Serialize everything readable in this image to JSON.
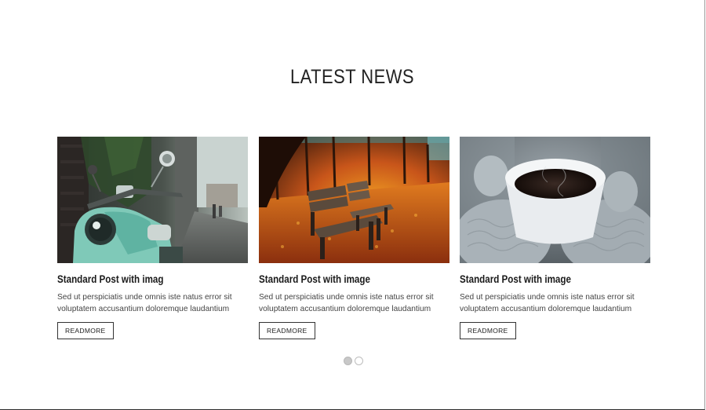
{
  "section": {
    "title": "LATEST NEWS"
  },
  "posts": [
    {
      "title": "Standard Post with imag",
      "excerpt": "Sed ut perspiciatis unde omnis iste natus error sit voluptatem accusantium doloremque laudantium",
      "button": "READMORE",
      "image": "scooter-photo"
    },
    {
      "title": "Standard Post with image",
      "excerpt": "Sed ut perspiciatis unde omnis iste natus error sit voluptatem accusantium doloremque laudantium",
      "button": "READMORE",
      "image": "autumn-bench-photo"
    },
    {
      "title": "Standard Post with image",
      "excerpt": "Sed ut perspiciatis unde omnis iste natus error sit voluptatem accusantium doloremque laudantium",
      "button": "READMORE",
      "image": "coffee-mittens-photo"
    }
  ],
  "pagination": {
    "pages": 2,
    "active": 1
  },
  "colors": {
    "text": "#222222",
    "excerpt": "#444444",
    "border": "#333333"
  }
}
